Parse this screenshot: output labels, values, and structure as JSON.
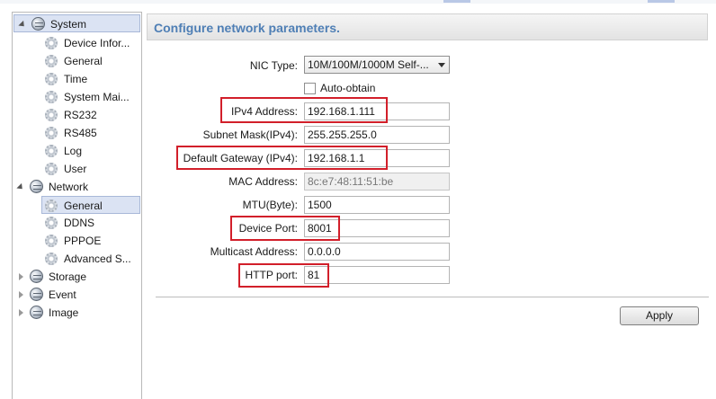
{
  "tree": {
    "system": {
      "label": "System",
      "children": [
        "Device Infor...",
        "General",
        "Time",
        "System Mai...",
        "RS232",
        "RS485",
        "Log",
        "User"
      ]
    },
    "network": {
      "label": "Network",
      "children": [
        "General",
        "DDNS",
        "PPPOE",
        "Advanced S..."
      ],
      "selected": "General"
    },
    "storage": {
      "label": "Storage"
    },
    "event": {
      "label": "Event"
    },
    "image": {
      "label": "Image"
    }
  },
  "form": {
    "title": "Configure network parameters.",
    "nic_type": {
      "label": "NIC Type:",
      "value": "10M/100M/1000M Self-..."
    },
    "auto_obtain": {
      "label": "Auto-obtain",
      "checked": false
    },
    "ipv4_address": {
      "label": "IPv4 Address:",
      "value": "192.168.1.111"
    },
    "subnet_mask": {
      "label": "Subnet Mask(IPv4):",
      "value": "255.255.255.0"
    },
    "default_gateway": {
      "label": "Default Gateway (IPv4):",
      "value": "192.168.1.1"
    },
    "mac_address": {
      "label": "MAC Address:",
      "value": "8c:e7:48:11:51:be"
    },
    "mtu": {
      "label": "MTU(Byte):",
      "value": "1500"
    },
    "device_port": {
      "label": "Device Port:",
      "value": "8001"
    },
    "multicast_address": {
      "label": "Multicast Address:",
      "value": "0.0.0.0"
    },
    "http_port": {
      "label": "HTTP port:",
      "value": "81"
    },
    "apply_label": "Apply"
  },
  "colors": {
    "highlight_box": "#d21f2a",
    "title": "#4f7fb5",
    "selection": "#dbe3f3"
  }
}
